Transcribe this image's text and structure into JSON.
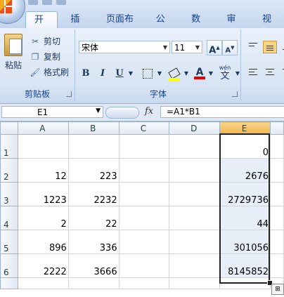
{
  "ribbon": {
    "tabs": [
      "开始",
      "插入",
      "页面布局",
      "公式",
      "数据",
      "审阅",
      "视"
    ],
    "clipboard": {
      "paste": "粘贴",
      "cut": "剪切",
      "copy": "复制",
      "format_painter": "格式刷",
      "label": "剪贴板"
    },
    "font": {
      "name": "宋体",
      "size": "11",
      "grow": "A",
      "shrink": "A",
      "bold": "B",
      "italic": "I",
      "underline": "U",
      "font_color": "A",
      "phonetic": "wén",
      "phonetic_glyph": "文",
      "label": "字体"
    }
  },
  "formula_bar": {
    "name_box": "E1",
    "fx": "fx",
    "formula": "=A1*B1"
  },
  "sheet": {
    "columns": [
      "A",
      "B",
      "C",
      "D",
      "E"
    ],
    "rows": [
      {
        "num": "1",
        "a": "",
        "b": "",
        "e": "0"
      },
      {
        "num": "2",
        "a": "12",
        "b": "223",
        "e": "2676"
      },
      {
        "num": "3",
        "a": "1223",
        "b": "2232",
        "e": "2729736"
      },
      {
        "num": "4",
        "a": "2",
        "b": "22",
        "e": "44"
      },
      {
        "num": "5",
        "a": "896",
        "b": "336",
        "e": "301056"
      },
      {
        "num": "6",
        "a": "2222",
        "b": "3666",
        "e": "8145852"
      }
    ],
    "selected_column": "E",
    "selection_color": "#e8eef7",
    "header_highlight": "#f1b54c"
  }
}
